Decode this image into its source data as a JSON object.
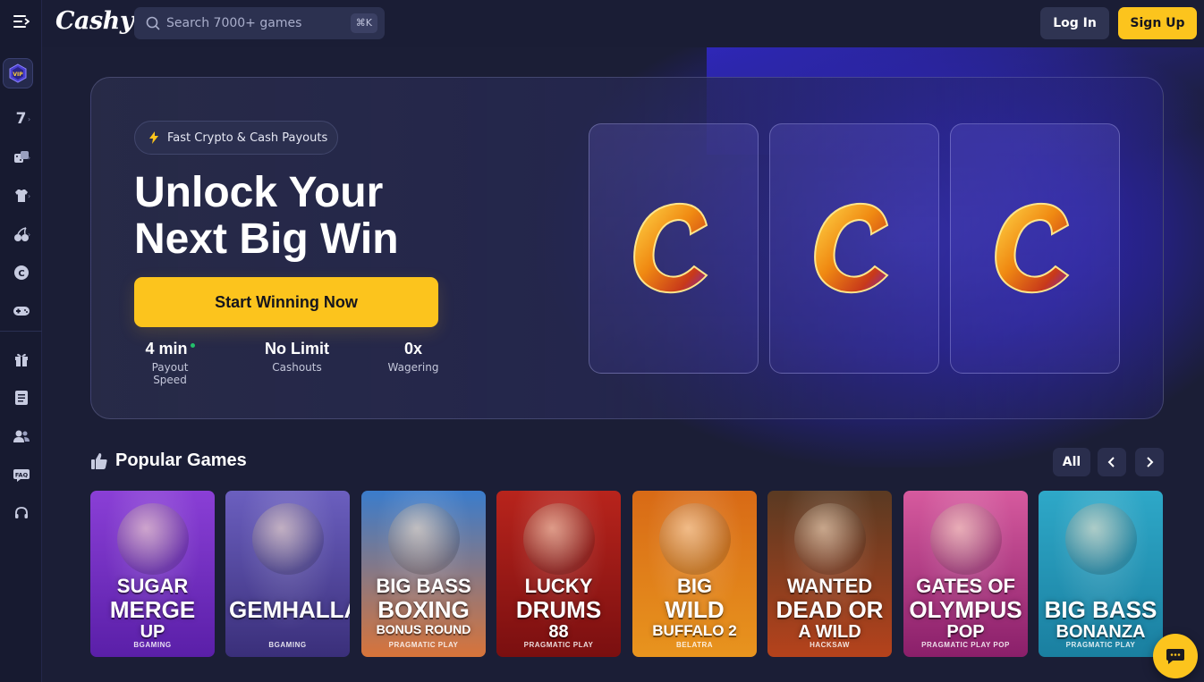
{
  "header": {
    "logo": "Cashy",
    "search_placeholder": "Search 7000+ games",
    "search_shortcut": "⌘K",
    "login_label": "Log In",
    "signup_label": "Sign Up"
  },
  "sidebar": {
    "vip_label": "VIP",
    "items": [
      {
        "icon": "slot-seven-icon",
        "has_submenu": true
      },
      {
        "icon": "dice-icon",
        "has_submenu": true
      },
      {
        "icon": "jersey-icon",
        "has_submenu": true
      },
      {
        "icon": "cherries-icon",
        "has_submenu": true
      },
      {
        "icon": "cashy-coin-icon",
        "has_submenu": false
      },
      {
        "icon": "gamepad-icon",
        "has_submenu": false
      },
      {
        "icon": "gift-icon",
        "has_submenu": false
      },
      {
        "icon": "ticket-icon",
        "has_submenu": false
      },
      {
        "icon": "users-icon",
        "has_submenu": false
      },
      {
        "icon": "faq-icon",
        "has_submenu": false
      },
      {
        "icon": "headset-icon",
        "has_submenu": false
      }
    ]
  },
  "hero": {
    "badge": "Fast Crypto & Cash Payouts",
    "title_line1": "Unlock Your",
    "title_line2": "Next Big Win",
    "cta_label": "Start Winning Now",
    "stats": [
      {
        "value": "4 min",
        "label": "Payout Speed"
      },
      {
        "value": "No Limit",
        "label": "Cashouts"
      },
      {
        "value": "0x",
        "label": "Wagering"
      }
    ],
    "reels": [
      "C",
      "C",
      "C"
    ]
  },
  "popular": {
    "title": "Popular Games",
    "all_label": "All",
    "games": [
      {
        "title": "Sugar Merge Up",
        "line1": "SUGAR",
        "line2": "MERGE",
        "line3": "UP",
        "provider": "BGAMING",
        "bg_top": "#8a3fd6",
        "bg_bottom": "#5a1fa8"
      },
      {
        "title": "Gemhalla",
        "line1": "",
        "line2": "GEMHALLA",
        "line3": "",
        "provider": "BGAMING",
        "bg_top": "#6b5fbf",
        "bg_bottom": "#3a2f7a"
      },
      {
        "title": "Big Bass Boxing Bonus Round",
        "line1": "BIG BASS",
        "line2": "BOXING",
        "line3": "BONUS ROUND",
        "provider": "PRAGMATIC PLAY",
        "bg_top": "#3a7ccc",
        "bg_bottom": "#d8743a"
      },
      {
        "title": "Lucky Drums 88",
        "line1": "LUCKY",
        "line2": "DRUMS",
        "line3": "88",
        "provider": "PRAGMATIC PLAY",
        "bg_top": "#b8241c",
        "bg_bottom": "#7a0f10"
      },
      {
        "title": "Big Wild Buffalo 2",
        "line1": "BIG",
        "line2": "WILD",
        "line3": "BUFFALO 2",
        "provider": "BELATRA",
        "bg_top": "#d86a16",
        "bg_bottom": "#e8941e"
      },
      {
        "title": "Wanted Dead or a Wild",
        "line1": "WANTED",
        "line2": "DEAD OR",
        "line3": "A WILD",
        "provider": "HACKSAW",
        "bg_top": "#5a3a22",
        "bg_bottom": "#b5421c"
      },
      {
        "title": "Gates of Olympus Pop",
        "line1": "GATES OF",
        "line2": "OLYMPUS",
        "line3": "POP",
        "provider": "PRAGMATIC PLAY POP",
        "bg_top": "#d65a9e",
        "bg_bottom": "#8a1f6a"
      },
      {
        "title": "Big Bass Bonanza",
        "line1": "",
        "line2": "BIG BASS",
        "line3": "BONANZA",
        "provider": "PRAGMATIC PLAY",
        "bg_top": "#2ea8c8",
        "bg_bottom": "#1a7fa0"
      }
    ]
  },
  "colors": {
    "accent": "#fcc41d",
    "background": "#1b1e36",
    "sidebar": "#171a30",
    "glow": "#3b32d6",
    "online_dot": "#23c16b"
  }
}
